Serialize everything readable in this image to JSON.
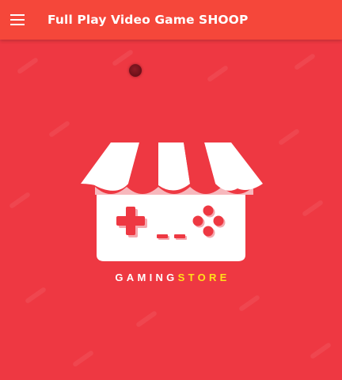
{
  "app_bar": {
    "title": "Full Play Video Game SHOOP",
    "menu_icon": "hamburger-menu-icon",
    "background_color": "#f5473a"
  },
  "content": {
    "background_color": "#ee3842",
    "loading_indicator": "spinner-dot"
  },
  "logo": {
    "icon": "gaming-store-icon",
    "brand_word_1": "GAMING",
    "brand_word_2": "STORE",
    "brand_word_1_color": "#ffffff",
    "brand_word_2_color": "#ffe01a"
  }
}
